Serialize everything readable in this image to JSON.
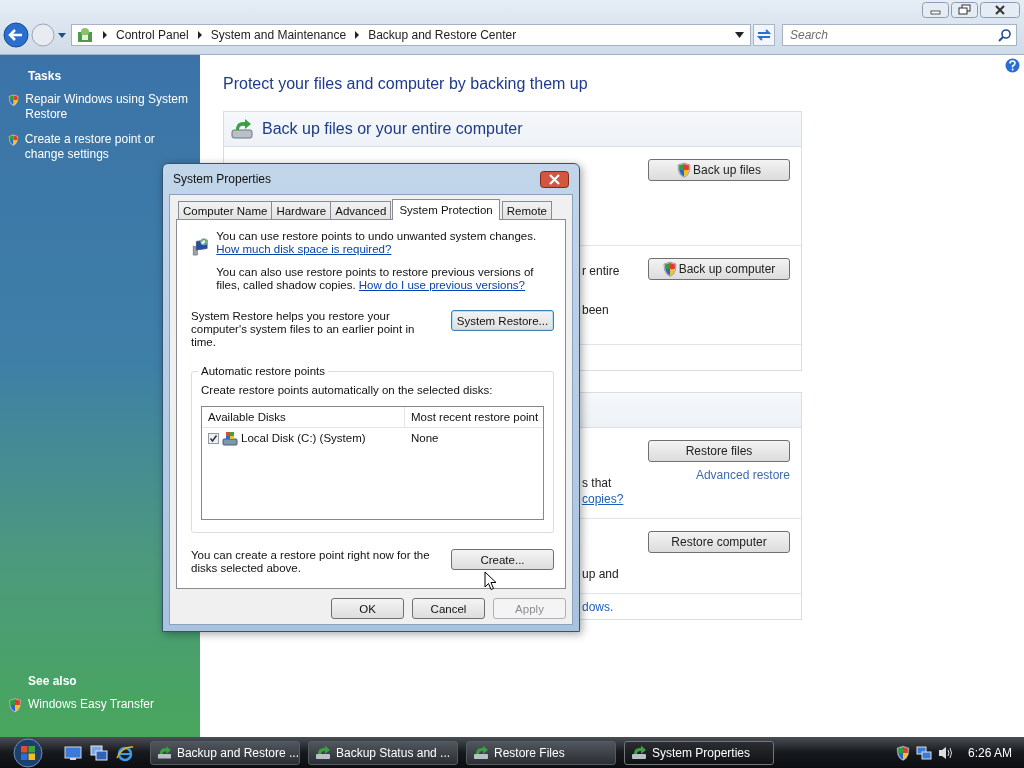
{
  "address_bar": {
    "breadcrumbs": [
      "Control Panel",
      "System and Maintenance",
      "Backup and Restore Center"
    ]
  },
  "search": {
    "placeholder": "Search"
  },
  "sidebar": {
    "tasks_heading": "Tasks",
    "tasks": [
      {
        "label": "Repair Windows using System Restore"
      },
      {
        "label": "Create a restore point or change settings"
      }
    ],
    "see_also_heading": "See also",
    "see_also": [
      {
        "label": "Windows Easy Transfer"
      }
    ]
  },
  "page": {
    "heading": "Protect your files and computer by backing them up",
    "sections": [
      {
        "title": "Back up files or your entire computer",
        "icon": true,
        "rows": [
          {
            "texts": [],
            "button": {
              "label": "Back up files",
              "shield": true
            }
          },
          {
            "texts": [
              {
                "text": "r entire",
                "kind": "plain"
              },
              {
                "text": "been",
                "kind": "plain"
              }
            ],
            "button": {
              "label": "Back up computer",
              "shield": true
            }
          }
        ]
      },
      {
        "rows": [
          {
            "texts": [
              {
                "text": "s that",
                "kind": "plain"
              },
              {
                "text": "copies?",
                "kind": "link"
              }
            ],
            "button": {
              "label": "Restore files",
              "shield": false
            },
            "link": "Advanced restore"
          },
          {
            "texts": [
              {
                "text": "up and",
                "kind": "plain"
              }
            ],
            "button": {
              "label": "Restore computer",
              "shield": false
            }
          }
        ],
        "footer": {
          "text": "dows.",
          "kind": "link"
        }
      }
    ]
  },
  "dialog": {
    "title": "System Properties",
    "tabs": [
      {
        "label": "Computer Name",
        "selected": false
      },
      {
        "label": "Hardware",
        "selected": false
      },
      {
        "label": "Advanced",
        "selected": false
      },
      {
        "label": "System Protection",
        "selected": true
      },
      {
        "label": "Remote",
        "selected": false
      }
    ],
    "intro": {
      "text": "You can use restore points to undo unwanted system changes.",
      "link": "How much disk space is required?"
    },
    "shadow": {
      "text": "You can also use restore points to restore previous versions of files, called shadow copies.",
      "link": "How do I use previous versions?"
    },
    "restore_text": "System Restore helps you restore your computer's system files to an earlier point in time.",
    "restore_button": "System Restore...",
    "group": {
      "legend": "Automatic restore points",
      "description": "Create restore points automatically on the selected disks:",
      "columns": [
        "Available Disks",
        "Most recent restore point"
      ],
      "disks": [
        {
          "name": "Local Disk (C:) (System)",
          "checked": true,
          "last_restore": "None"
        }
      ]
    },
    "create_text": "You can create a restore point right now for the disks selected above.",
    "create_button": "Create...",
    "buttons": [
      {
        "label": "OK",
        "disabled": false
      },
      {
        "label": "Cancel",
        "disabled": false
      },
      {
        "label": "Apply",
        "disabled": true
      }
    ]
  },
  "taskbar": {
    "tasks": [
      {
        "label": "Backup and Restore ...",
        "selected": false
      },
      {
        "label": "Backup Status and ...",
        "selected": false
      },
      {
        "label": "Restore Files",
        "selected": false
      },
      {
        "label": "System Properties",
        "selected": true
      }
    ],
    "clock": "6:26 AM"
  }
}
